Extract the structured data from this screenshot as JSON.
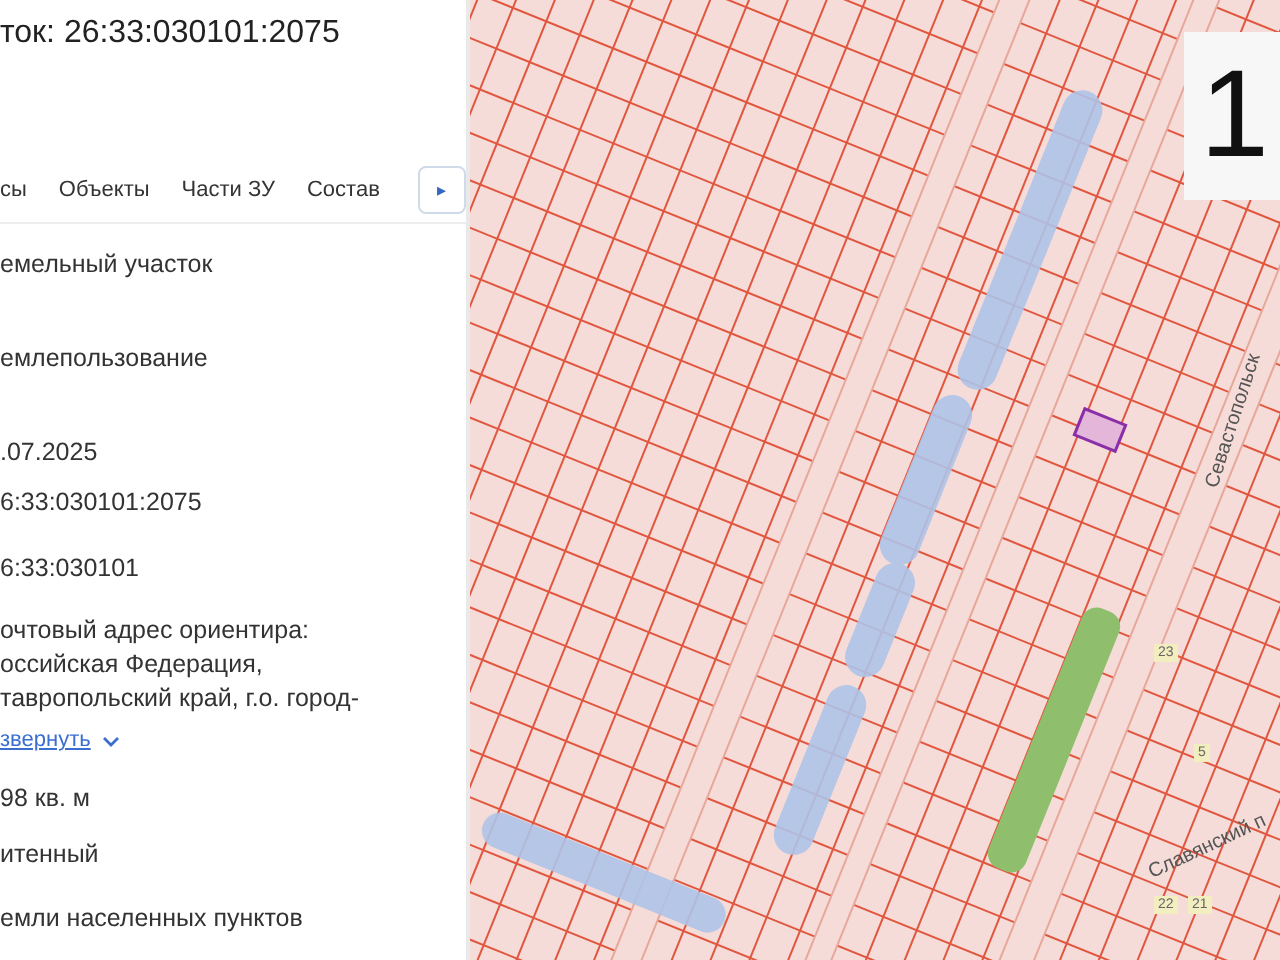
{
  "title": "ток: 26:33:030101:2075",
  "tabs": [
    "сы",
    "Объекты",
    "Части ЗУ",
    "Состав"
  ],
  "tab_scroll": "▸",
  "fields": [
    {
      "kind": "text",
      "lines": [
        "емельный участок"
      ]
    },
    {
      "kind": "text",
      "lines": [
        "емлепользование"
      ]
    },
    {
      "kind": "text",
      "lines": [
        ".07.2025"
      ]
    },
    {
      "kind": "text",
      "lines": [
        "6:33:030101:2075"
      ]
    },
    {
      "kind": "text",
      "lines": [
        "6:33:030101"
      ]
    },
    {
      "kind": "address",
      "lines": [
        "очтовый адрес ориентира:",
        "оссийская Федерация,",
        "тавропольский край, г.о. город-"
      ],
      "link": "звернуть"
    },
    {
      "kind": "text",
      "lines": [
        "98 кв. м"
      ]
    },
    {
      "kind": "text",
      "lines": [
        "итенный"
      ]
    },
    {
      "kind": "text",
      "lines": [
        "емли населенных пунктов"
      ]
    }
  ],
  "map": {
    "streets": [
      "Севастопольск",
      "Славянский п"
    ],
    "house_numbers": [
      "23",
      "5",
      "22",
      "21"
    ],
    "scale_badge": "1"
  }
}
